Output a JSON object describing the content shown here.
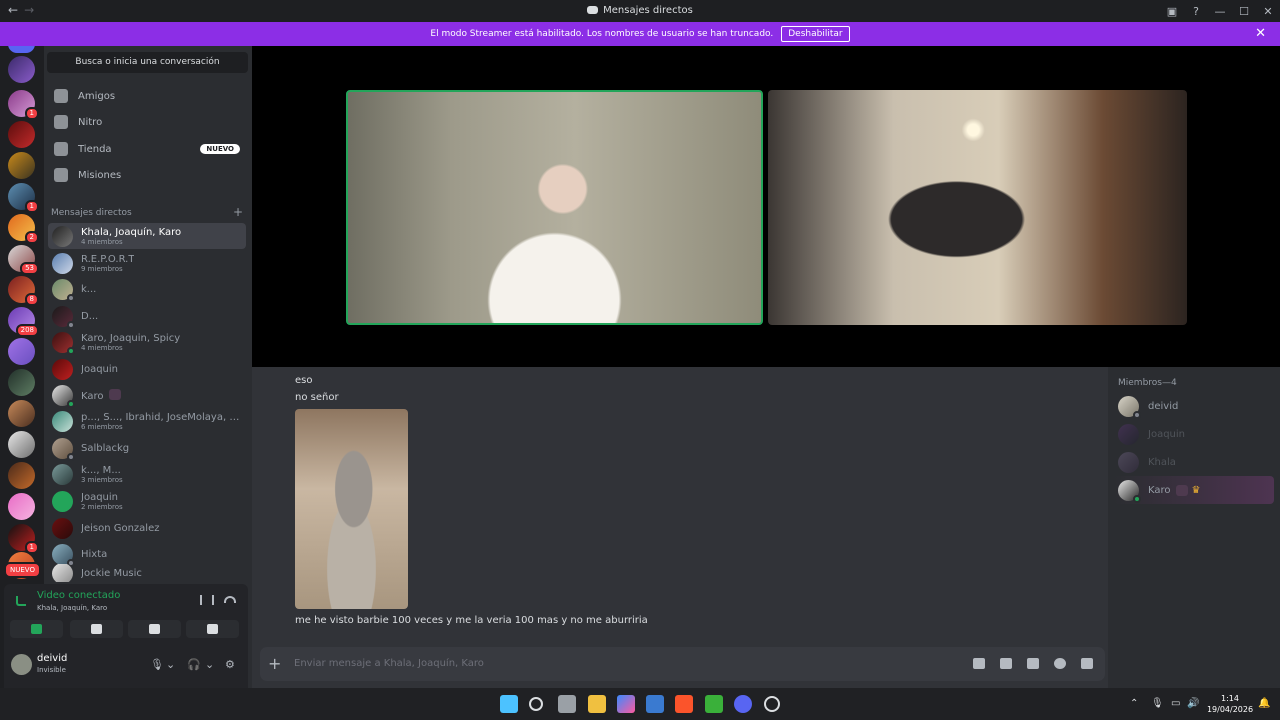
{
  "window": {
    "title": "Mensajes directos",
    "back": "←",
    "forward": "→"
  },
  "banner": {
    "text": "El modo Streamer está habilitado. Los nombres de usuario se han truncado.",
    "button": "Deshabilitar",
    "close": "✕"
  },
  "guilds": {
    "badges": [
      "1",
      "1",
      "2",
      "53",
      "8",
      "208",
      "1"
    ],
    "new_label": "NUEVO"
  },
  "sidebar": {
    "search": "Busca o inicia una conversación",
    "nav": [
      {
        "label": "Amigos"
      },
      {
        "label": "Nitro"
      },
      {
        "label": "Tienda",
        "tag": "NUEVO"
      },
      {
        "label": "Misiones"
      }
    ],
    "dm_header": "Mensajes directos",
    "dm_add": "+",
    "dms": [
      {
        "name": "Khala, Joaquín, Karo",
        "sub": "4 miembros",
        "active": true
      },
      {
        "name": "R.E.P.O.R.T",
        "sub": "9 miembros"
      },
      {
        "name": "k..."
      },
      {
        "name": "D..."
      },
      {
        "name": "Karo, Joaquin, Spicy",
        "sub": "4 miembros"
      },
      {
        "name": "Joaquin"
      },
      {
        "name": "Karo"
      },
      {
        "name": "p..., S..., Ibrahid, JoseMolaya, Jud...",
        "sub": "6 miembros"
      },
      {
        "name": "Salblackg"
      },
      {
        "name": "k..., M...",
        "sub": "3 miembros"
      },
      {
        "name": "Joaquin",
        "sub": "2 miembros"
      },
      {
        "name": "Jeison Gonzalez"
      },
      {
        "name": "Hixta"
      },
      {
        "name": "Jockie Music"
      }
    ]
  },
  "voice": {
    "status": "Video conectado",
    "channel": "Khala, Joaquín, Karo"
  },
  "user": {
    "name": "deivid",
    "status": "Invisible"
  },
  "chat": {
    "messages": [
      "eso",
      "no señor",
      "me he visto barbie 100 veces y me la veria 100 mas y no me aburriria"
    ],
    "placeholder": "Enviar mensaje a Khala, Joaquín, Karo"
  },
  "members": {
    "header": "Miembros—4",
    "list": [
      {
        "name": "deivid"
      },
      {
        "name": "Joaquin"
      },
      {
        "name": "Khala"
      },
      {
        "name": "Karo"
      }
    ]
  },
  "taskbar": {
    "time": "1:14",
    "date": "19/04/2026"
  },
  "colors": {
    "banner": "#8c2ee6",
    "online": "#23a55a",
    "badge": "#f23f43",
    "blurple": "#5865f2"
  }
}
